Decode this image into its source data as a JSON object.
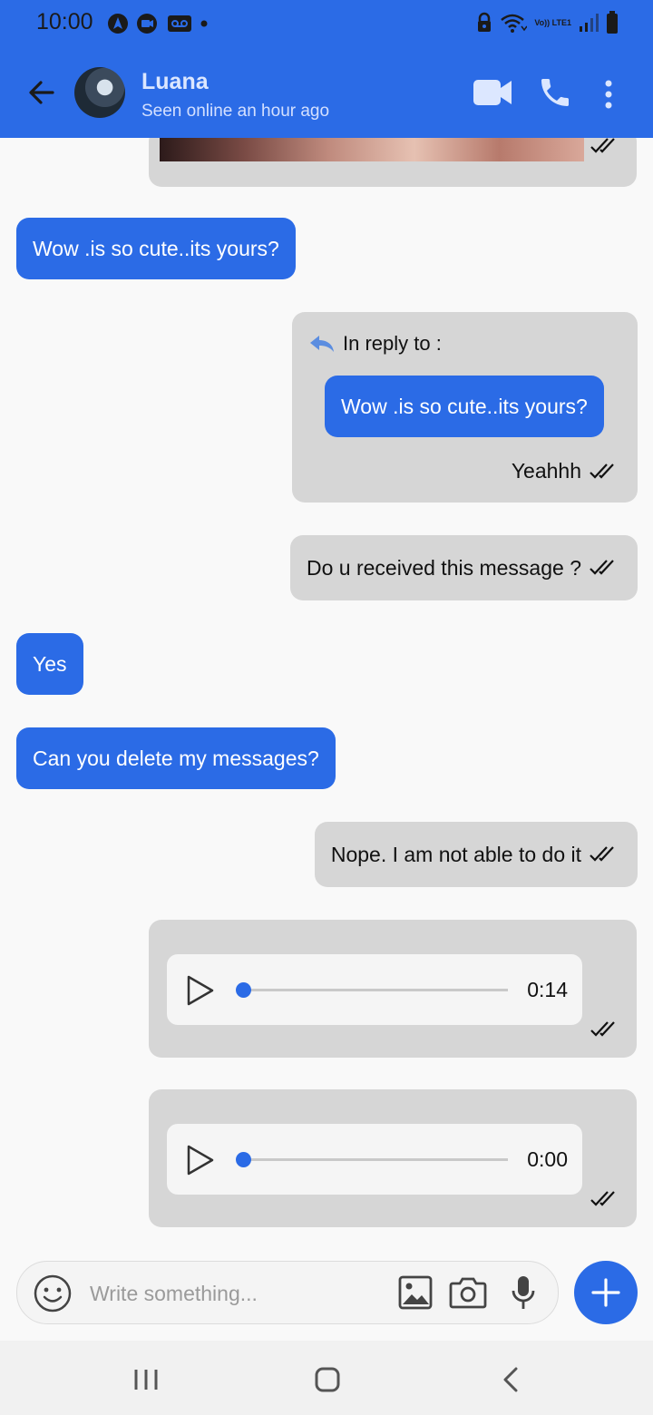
{
  "status_bar": {
    "time": "10:00",
    "icons_left": [
      "navigation-icon",
      "video-call-icon",
      "voicemail-icon",
      "notification-dot-icon"
    ],
    "icons_right": [
      "lock-icon",
      "wifi-icon",
      "volte-lte-icon",
      "signal-icon",
      "battery-icon"
    ],
    "network_label": "Vo)) LTE1"
  },
  "header": {
    "background_color": "#2b6be6",
    "contact_name": "Luana",
    "contact_status": "Seen online an hour ago",
    "icons": [
      "back-arrow-icon",
      "video-call-icon",
      "phone-icon",
      "more-vertical-icon"
    ]
  },
  "chat": {
    "messages": [
      {
        "type": "image",
        "direction": "outgoing",
        "status": "read"
      },
      {
        "type": "text",
        "direction": "incoming",
        "text": "Wow .is so cute..its yours?"
      },
      {
        "type": "reply",
        "direction": "outgoing",
        "reply_label": "In reply to :",
        "quoted_text": "Wow .is so cute..its yours?",
        "text": "Yeahhh",
        "status": "read"
      },
      {
        "type": "text",
        "direction": "outgoing",
        "text": "Do u received this message ?",
        "status": "read"
      },
      {
        "type": "text",
        "direction": "incoming",
        "text": "Yes"
      },
      {
        "type": "text",
        "direction": "incoming",
        "text": "Can you delete my messages?"
      },
      {
        "type": "text",
        "direction": "outgoing",
        "text": "Nope. I am not able to do it",
        "status": "read"
      },
      {
        "type": "audio",
        "direction": "outgoing",
        "duration": "0:14",
        "progress": 0,
        "status": "read"
      },
      {
        "type": "audio",
        "direction": "outgoing",
        "duration": "0:00",
        "progress": 0,
        "status": "read"
      }
    ]
  },
  "composer": {
    "placeholder": "Write something...",
    "value": "",
    "icons": [
      "emoji-icon",
      "gallery-icon",
      "camera-icon",
      "mic-icon"
    ],
    "add_button_icon": "plus-icon"
  },
  "nav_bar": {
    "icons": [
      "recent-apps-icon",
      "home-icon",
      "back-icon"
    ]
  }
}
